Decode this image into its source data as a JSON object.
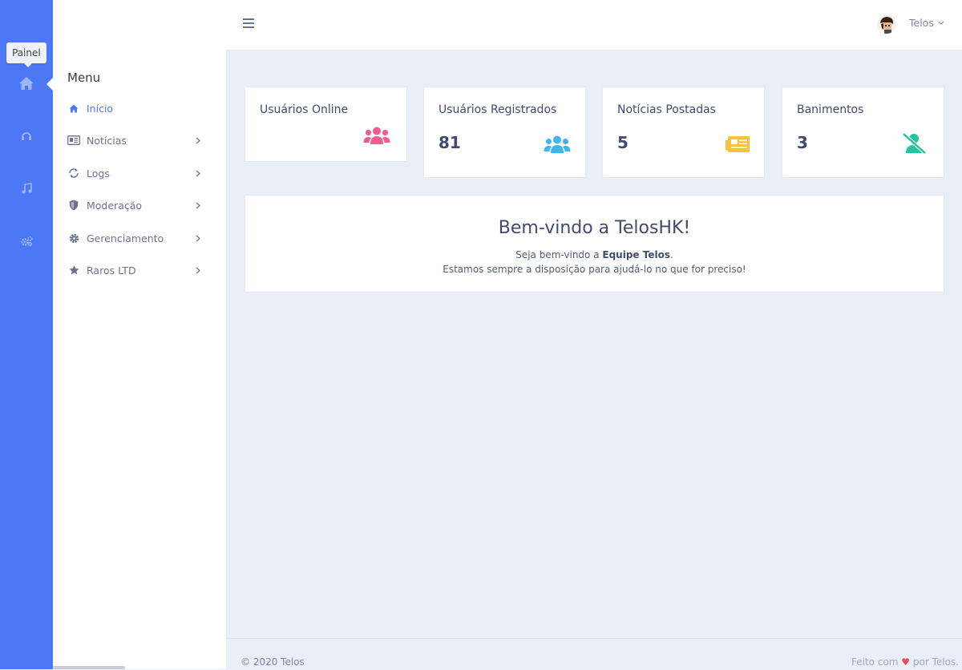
{
  "rail": {
    "tooltip": "Painel",
    "icons": [
      "home-icon",
      "headset-icon",
      "music-icon",
      "gears-icon"
    ]
  },
  "sidebar": {
    "title": "Menu",
    "items": [
      {
        "label": "Início",
        "icon": "home-icon",
        "active": true
      },
      {
        "label": "Notícias",
        "icon": "newspaper-icon"
      },
      {
        "label": "Logs",
        "icon": "refresh-icon"
      },
      {
        "label": "Moderação",
        "icon": "shield-icon"
      },
      {
        "label": "Gerenciamento",
        "icon": "gear-icon"
      },
      {
        "label": "Raros LTD",
        "icon": "star-icon"
      }
    ]
  },
  "header": {
    "user_name": "Telos"
  },
  "cards": [
    {
      "title": "Usuários Online",
      "value": "",
      "icon": "users-icon",
      "color": "#f45c8d"
    },
    {
      "title": "Usuários Registrados",
      "value": "81",
      "icon": "users-icon",
      "color": "#3fb6ef"
    },
    {
      "title": "Notícias Postadas",
      "value": "5",
      "icon": "newspaper-icon",
      "color": "#f8c23a"
    },
    {
      "title": "Banimentos",
      "value": "3",
      "icon": "user-slash-icon",
      "color": "#20c5a0"
    }
  ],
  "welcome": {
    "heading": "Bem-vindo a TelosHK!",
    "line1_prefix": "Seja bem-vindo a ",
    "line1_bold": "Equipe Telos",
    "line1_suffix": ".",
    "line2": "Estamos sempre a disposição para ajudá-lo no que for preciso!"
  },
  "footer": {
    "copyright": "© 2020 Telos",
    "made_prefix": "Feito com ",
    "made_heart": "♥",
    "made_suffix": " por Telos."
  },
  "colors": {
    "accent": "#4c78f6",
    "background": "#e9eef7"
  }
}
